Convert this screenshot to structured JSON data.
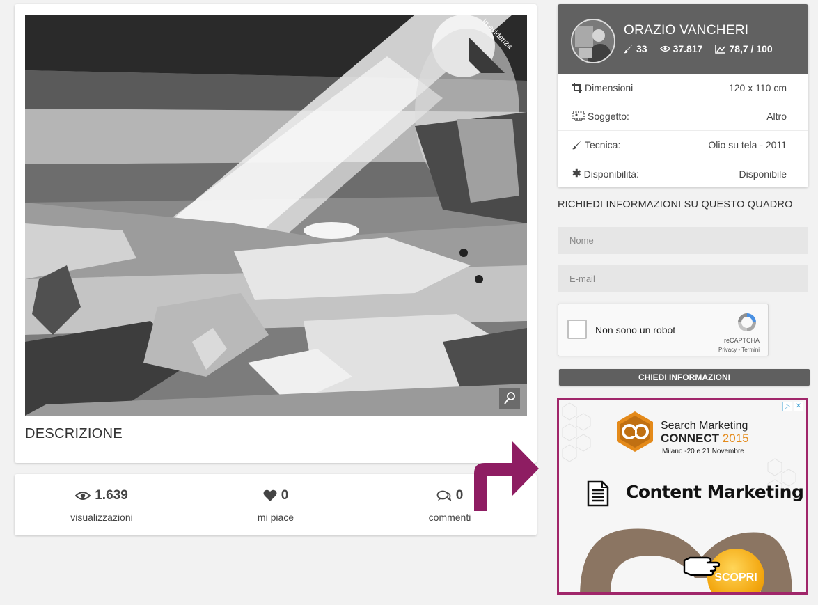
{
  "artwork": {
    "ribbon": "In evidenza",
    "description_title": "DESCRIZIONE"
  },
  "stats": [
    {
      "icon": "eye-icon",
      "value": "1.639",
      "label": "visualizzazioni"
    },
    {
      "icon": "heart-icon",
      "value": "0",
      "label": "mi piace"
    },
    {
      "icon": "comments-icon",
      "value": "0",
      "label": "commenti"
    }
  ],
  "artist": {
    "name": "ORAZIO VANCHERI",
    "works": "33",
    "views": "37.817",
    "score": "78,7 / 100"
  },
  "details": [
    {
      "icon": "crop-icon",
      "label": "Dimensioni",
      "value": "120 x 110 cm"
    },
    {
      "icon": "subject-icon",
      "label": "Soggetto:",
      "value": "Altro"
    },
    {
      "icon": "brush-icon",
      "label": "Tecnica:",
      "value": "Olio su tela - 2011"
    },
    {
      "icon": "asterisk-icon",
      "label": "Disponibilità:",
      "value": "Disponibile"
    }
  ],
  "form": {
    "title": "RICHIEDI INFORMAZIONI SU QUESTO QUADRO",
    "name_placeholder": "Nome",
    "email_placeholder": "E-mail",
    "captcha_label": "Non sono un robot",
    "captcha_brand": "reCAPTCHA",
    "captcha_links": "Privacy - Termini",
    "submit_label": "CHIEDI INFORMAZIONI"
  },
  "ad": {
    "brand_line1": "Search Marketing",
    "brand_line2": "CONNECT",
    "brand_year": "2015",
    "date": "Milano -20 e 21 Novembre",
    "headline": "Content Marketing",
    "cta": "SCOPRI",
    "accent_color": "#a0266a"
  },
  "colors": {
    "header_gray": "#616161",
    "button_gray": "#5f5f5f",
    "arrow_magenta": "#8e1d62"
  }
}
